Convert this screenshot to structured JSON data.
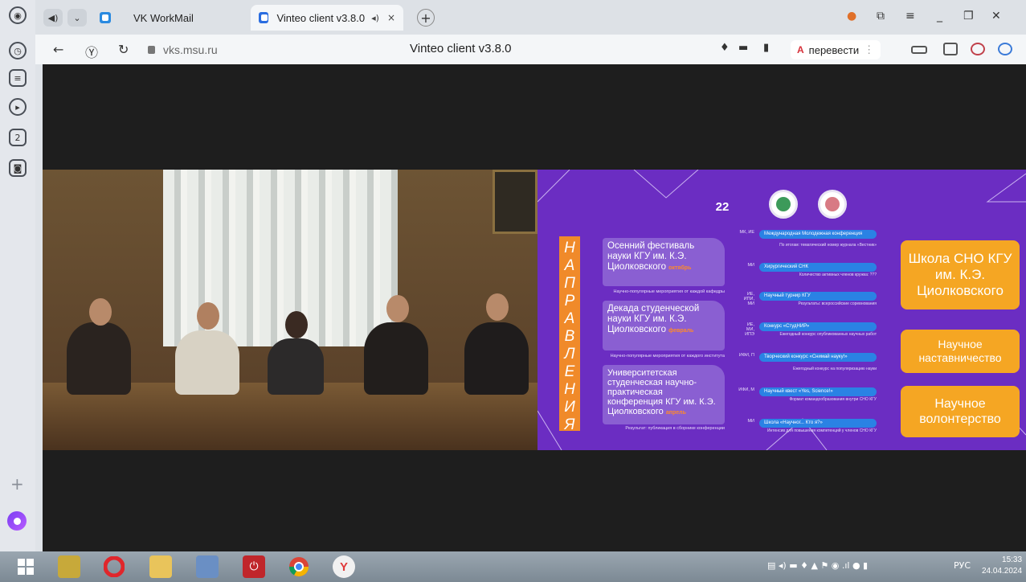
{
  "browser": {
    "tabs": [
      {
        "label": "VK WorkMail"
      },
      {
        "label": "Vinteo client v3.8.0",
        "active": true
      }
    ],
    "tab_close": "×",
    "new_tab": "+",
    "address": {
      "domain": "vks.msu.ru",
      "page_title": "Vinteo client v3.8.0",
      "translate_label": "перевести"
    },
    "sidebar_badge": "2"
  },
  "slide": {
    "vertical_word": [
      "Н",
      "А",
      "П",
      "Р",
      "А",
      "В",
      "Л",
      "Е",
      "Н",
      "И",
      "Я"
    ],
    "logo_text": "22",
    "left_blocks": [
      {
        "title": "Осенний фестиваль науки КГУ им. К.Э. Циолковского",
        "month": "октябрь",
        "note": "Научно-популярные мероприятия от каждой кафедры"
      },
      {
        "title": "Декада студенческой науки КГУ им. К.Э. Циолковского",
        "month": "февраль",
        "note": "Научно-популярные мероприятия от каждого института"
      },
      {
        "title": "Университетская студенческая научно-практическая конференция КГУ им. К.Э. Циолковского",
        "month": "апрель",
        "note": "Результат: публикация в сборнике конференции"
      }
    ],
    "middle_items": [
      {
        "abbr": "МК, ИЕ",
        "title": "Международная Молодежная конференция",
        "note": "По итогам: тематический номер журнала «Вестник»"
      },
      {
        "abbr": "МИ",
        "title": "Хирургический СНК",
        "note": "Количество активных членов кружка: ???"
      },
      {
        "abbr": "ИЕ, ИПИ, МИ",
        "title": "Научный турнир КГУ",
        "note": "Результаты: всероссийские соревнования"
      },
      {
        "abbr": "ИЕ, МИ, ИПЭ",
        "title": "Конкурс «СтудНИР»",
        "note": "Ежегодный конкурс опубликованных научных работ"
      },
      {
        "abbr": "ИФИ, П",
        "title": "Творческий конкурс «Снимай науку!»",
        "note": "Ежегодный конкурс на популяризацию науки"
      },
      {
        "abbr": "ИФИ, М",
        "title": "Научный квест «Yes, Science!»",
        "note": "Формат командообразования внутри СНО КГУ"
      },
      {
        "abbr": "МИ",
        "title": "Школа «Научног... Кто я?»",
        "note": "Интенсив для повышения компетенций у членов СНО КГУ"
      }
    ],
    "right_boxes": [
      {
        "text": "Школа СНО КГУ им. К.Э. Циолковского"
      },
      {
        "text": "Научное наставничество"
      },
      {
        "text": "Научное волонтерство"
      }
    ]
  },
  "taskbar": {
    "language": "РУС",
    "time": "15:33",
    "date": "24.04.2024"
  },
  "colors": {
    "slide_bg": "#6b2dc2",
    "orange": "#f5a623",
    "pill_blue": "#2a82e4"
  }
}
